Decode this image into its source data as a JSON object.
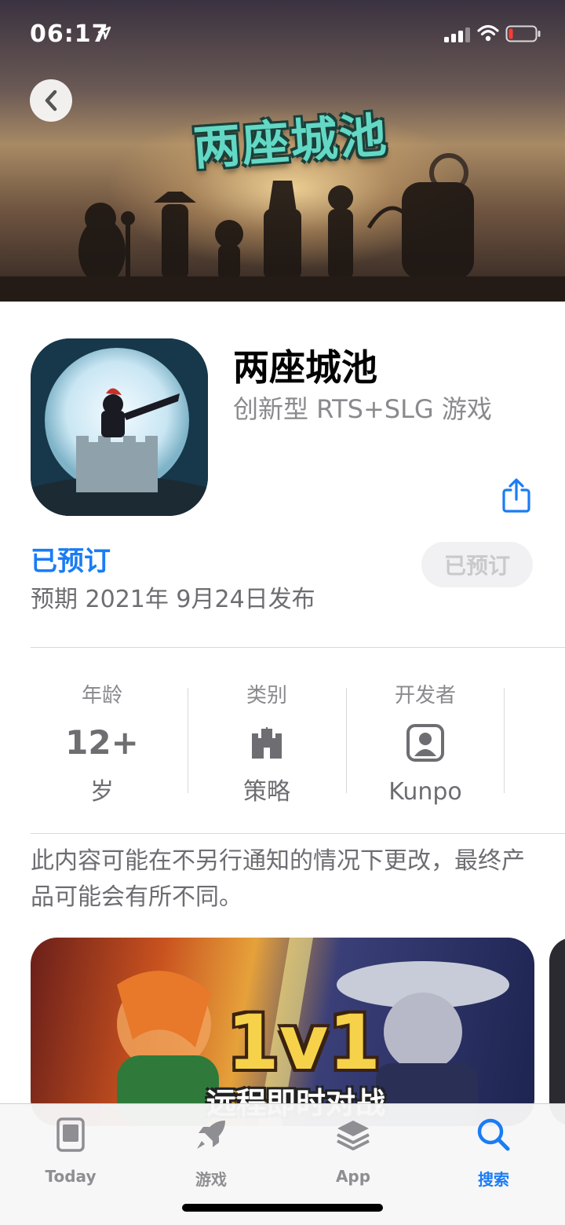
{
  "status_bar": {
    "time": "06:17"
  },
  "header": {
    "banner_logo_text": "两座城池"
  },
  "app": {
    "title": "两座城池",
    "subtitle": "创新型 RTS+SLG 游戏",
    "preorder_status": "已预订",
    "release_text": "预期 2021年 9月24日发布",
    "preorder_button_label": "已预订"
  },
  "info": {
    "age": {
      "label": "年龄",
      "value": "12+",
      "unit": "岁"
    },
    "category": {
      "label": "类别",
      "icon": "castle-icon",
      "value": "策略"
    },
    "developer": {
      "label": "开发者",
      "icon": "person-square-icon",
      "value": "Kunpo"
    }
  },
  "notice": "此内容可能在不另行通知的情况下更改，最终产品可能会有所不同。",
  "screenshot": {
    "badge": "1v1",
    "caption": "远程即时对战"
  },
  "tabbar": {
    "items": [
      {
        "label": "Today",
        "icon": "today-icon"
      },
      {
        "label": "游戏",
        "icon": "rocket-icon"
      },
      {
        "label": "App",
        "icon": "layers-icon"
      },
      {
        "label": "搜索",
        "icon": "search-icon"
      }
    ],
    "active": "搜索"
  },
  "colors": {
    "accent": "#1a7cf5",
    "secondary_text": "#8a8a8e"
  }
}
